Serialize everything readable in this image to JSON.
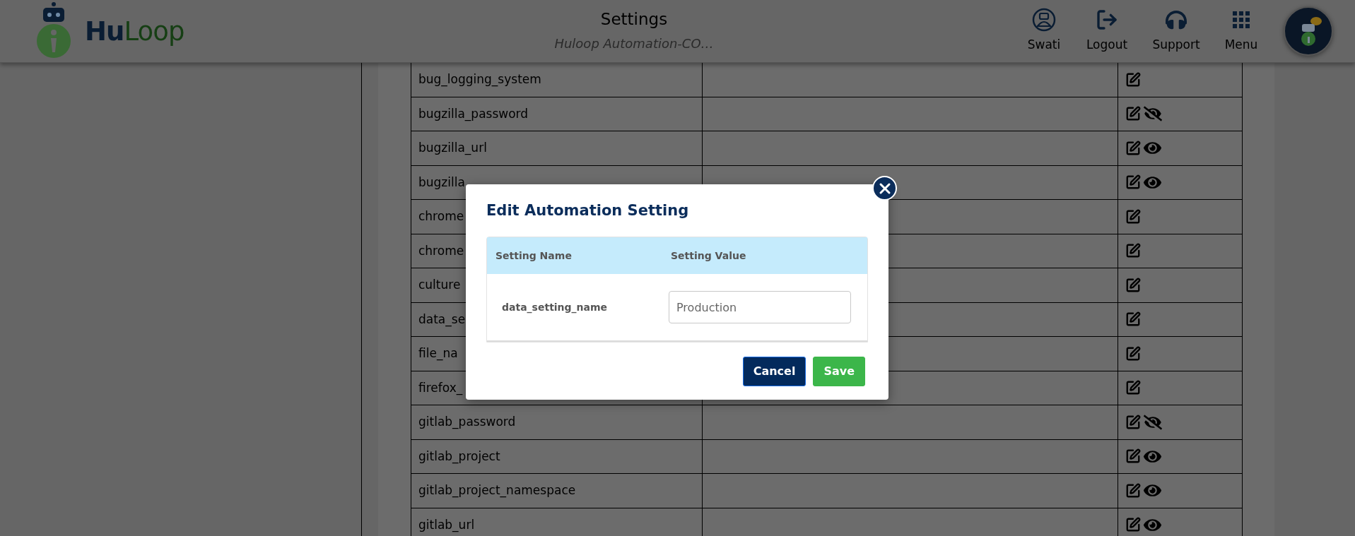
{
  "header": {
    "logo": [
      "Hu",
      "Loop"
    ],
    "title": "Settings",
    "subtitle": "Huloop Automation-CO…",
    "nav": [
      {
        "label": "Swati",
        "kind": "user"
      },
      {
        "label": "Logout",
        "kind": "logout"
      },
      {
        "label": "Support",
        "kind": "support"
      },
      {
        "label": "Menu",
        "kind": "menu"
      }
    ]
  },
  "table": {
    "rows": [
      {
        "name": "bug_logging_system",
        "kind": "plain"
      },
      {
        "name": "bugzilla_password",
        "kind": "masked"
      },
      {
        "name": "bugzilla_url",
        "kind": "revealed"
      },
      {
        "name": "bugzilla",
        "kind": "revealed"
      },
      {
        "name": "chrome",
        "kind": "plain"
      },
      {
        "name": "chrome",
        "kind": "plain"
      },
      {
        "name": "culture",
        "kind": "plain"
      },
      {
        "name": "data_se",
        "kind": "plain"
      },
      {
        "name": "file_na",
        "kind": "plain"
      },
      {
        "name": "firefox_",
        "kind": "plain"
      },
      {
        "name": "gitlab_password",
        "kind": "masked"
      },
      {
        "name": "gitlab_project",
        "kind": "revealed"
      },
      {
        "name": "gitlab_project_namespace",
        "kind": "revealed"
      },
      {
        "name": "gitlab_url",
        "kind": "revealed"
      }
    ]
  },
  "dialog": {
    "title": "Edit Automation Setting",
    "columns": [
      "Setting Name",
      "Setting Value"
    ],
    "row": {
      "name": "data_setting_name",
      "value": "Production"
    },
    "buttons": [
      {
        "label": "Cancel",
        "kind": "secondary"
      },
      {
        "label": "Save",
        "kind": "primary"
      }
    ]
  }
}
